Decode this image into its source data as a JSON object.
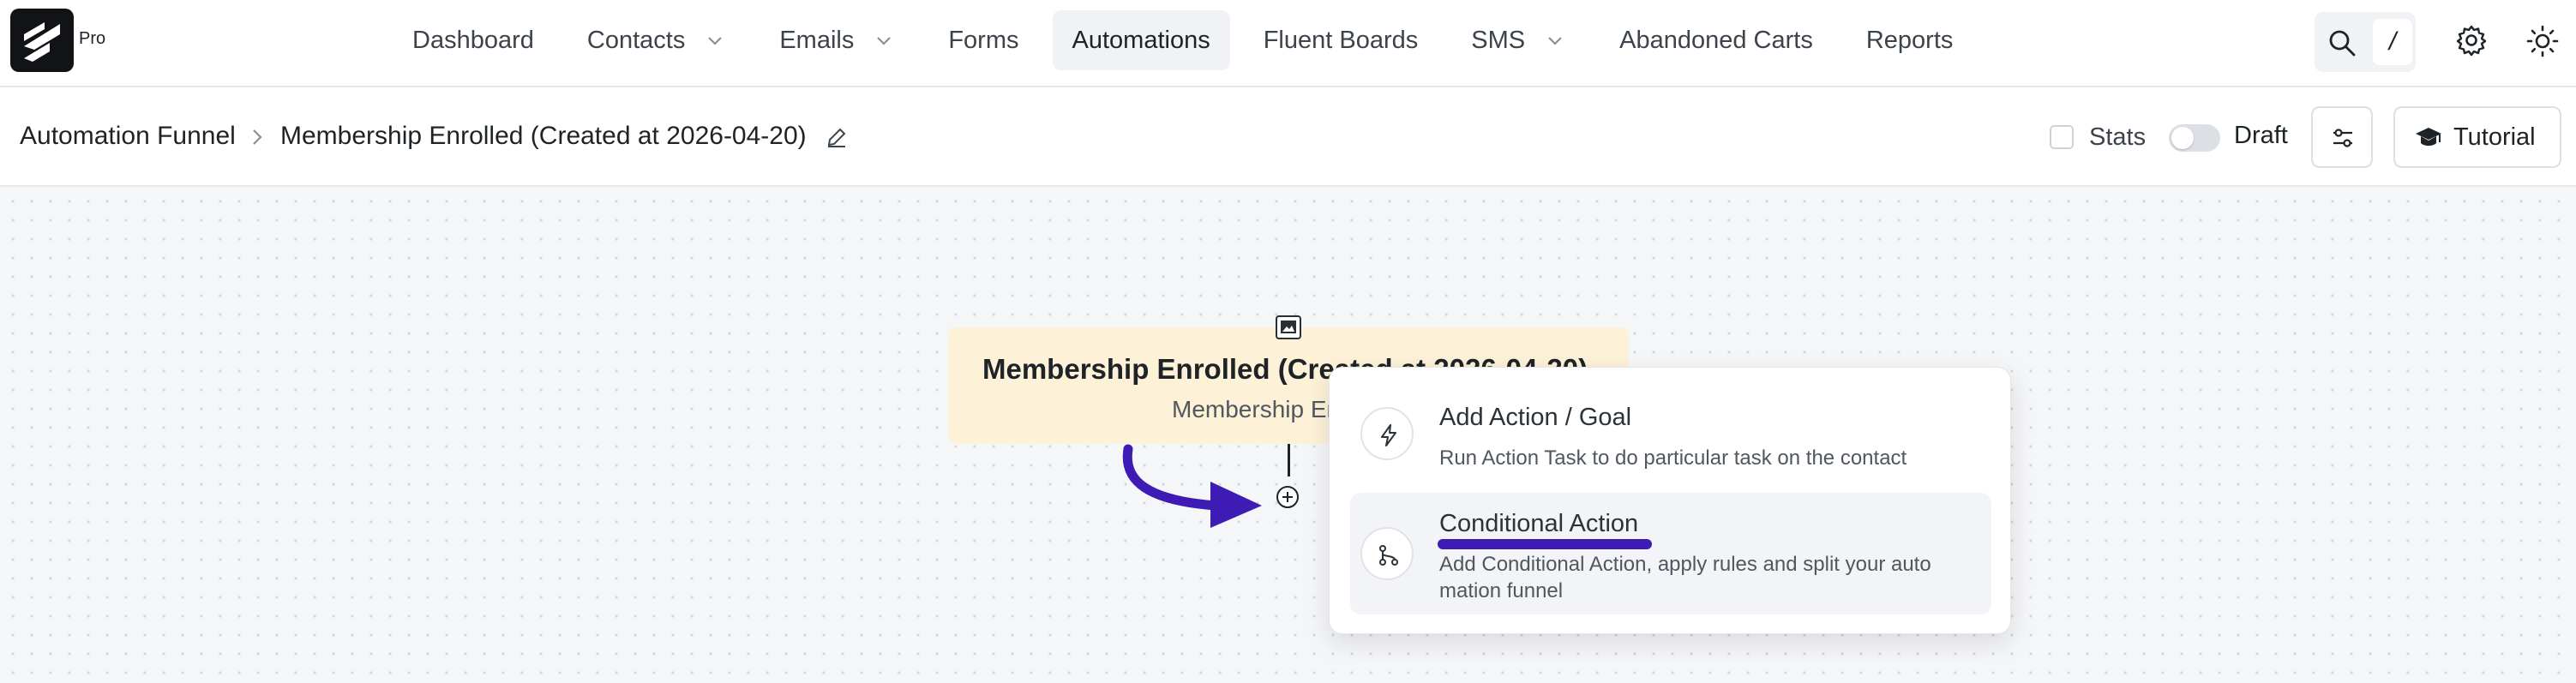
{
  "brand": {
    "badge": "Pro"
  },
  "nav": {
    "items": [
      {
        "label": "Dashboard",
        "dropdown": false,
        "active": false
      },
      {
        "label": "Contacts",
        "dropdown": true,
        "active": false
      },
      {
        "label": "Emails",
        "dropdown": true,
        "active": false
      },
      {
        "label": "Forms",
        "dropdown": false,
        "active": false
      },
      {
        "label": "Automations",
        "dropdown": false,
        "active": true
      },
      {
        "label": "Fluent Boards",
        "dropdown": false,
        "active": false
      },
      {
        "label": "SMS",
        "dropdown": true,
        "active": false
      },
      {
        "label": "Abandoned Carts",
        "dropdown": false,
        "active": false
      },
      {
        "label": "Reports",
        "dropdown": false,
        "active": false
      }
    ],
    "search_shortcut": "/",
    "icons": {
      "search": "search-icon",
      "settings": "gear-icon",
      "theme": "sun-icon"
    }
  },
  "breadcrumb": {
    "root": "Automation Funnel",
    "current": "Membership Enrolled (Created at 2026-04-20)"
  },
  "toolbar": {
    "stats_label": "Stats",
    "stats_checked": false,
    "draft_label": "Draft",
    "draft_on": false,
    "tutorial_label": "Tutorial"
  },
  "canvas": {
    "trigger": {
      "title": "Membership Enrolled (Created at 2026-04-20)",
      "subtitle": "Membership Enrolled"
    }
  },
  "popover": {
    "options": [
      {
        "title": "Add Action / Goal",
        "description": "Run Action Task to do particular task on the contact",
        "icon": "lightning-icon"
      },
      {
        "title": "Conditional Action",
        "description": "Add Conditional Action, apply rules and split your auto mation funnel",
        "icon": "branch-icon"
      }
    ]
  },
  "colors": {
    "annotation": "#3d1bb4",
    "trigger_card": "#fdf1d8",
    "active_nav": "#f0f2f5"
  }
}
